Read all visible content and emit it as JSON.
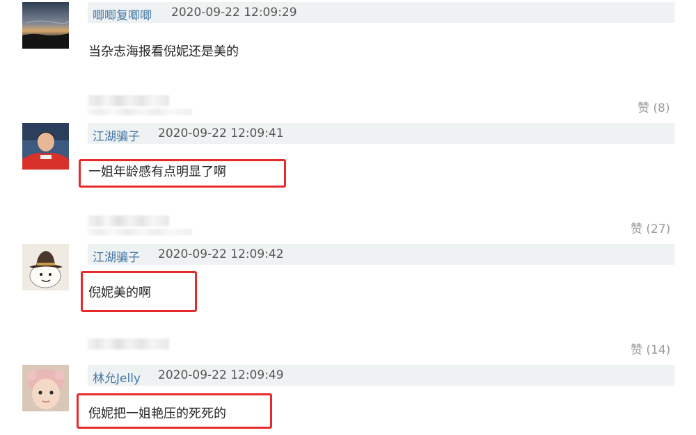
{
  "comments": [
    {
      "username": "唧唧复唧唧",
      "time": "2020-09-22 12:09:29",
      "text": "当杂志海报看倪妮还是美的",
      "likes": "赞 (8)",
      "avatar": "sunset-landscape-avatar"
    },
    {
      "username": "江湖骗子",
      "time": "2020-09-22 12:09:41",
      "text": "一姐年龄感有点明显了啊",
      "likes": "赞 (27)",
      "avatar": "person-red-shirt-avatar"
    },
    {
      "username": "江湖骗子",
      "time": "2020-09-22 12:09:42",
      "text": "倪妮美的啊",
      "likes": "赞 (14)",
      "avatar": "cartoon-hat-avatar"
    },
    {
      "username": "林允Jelly",
      "time": "2020-09-22 12:09:49",
      "text": "倪妮把一姐艳压的死死的",
      "avatar": "baby-avatar"
    }
  ],
  "colors": {
    "username": "#4576a5",
    "highlight": "#e62a2a",
    "meta_bar": "#eef2f2"
  }
}
